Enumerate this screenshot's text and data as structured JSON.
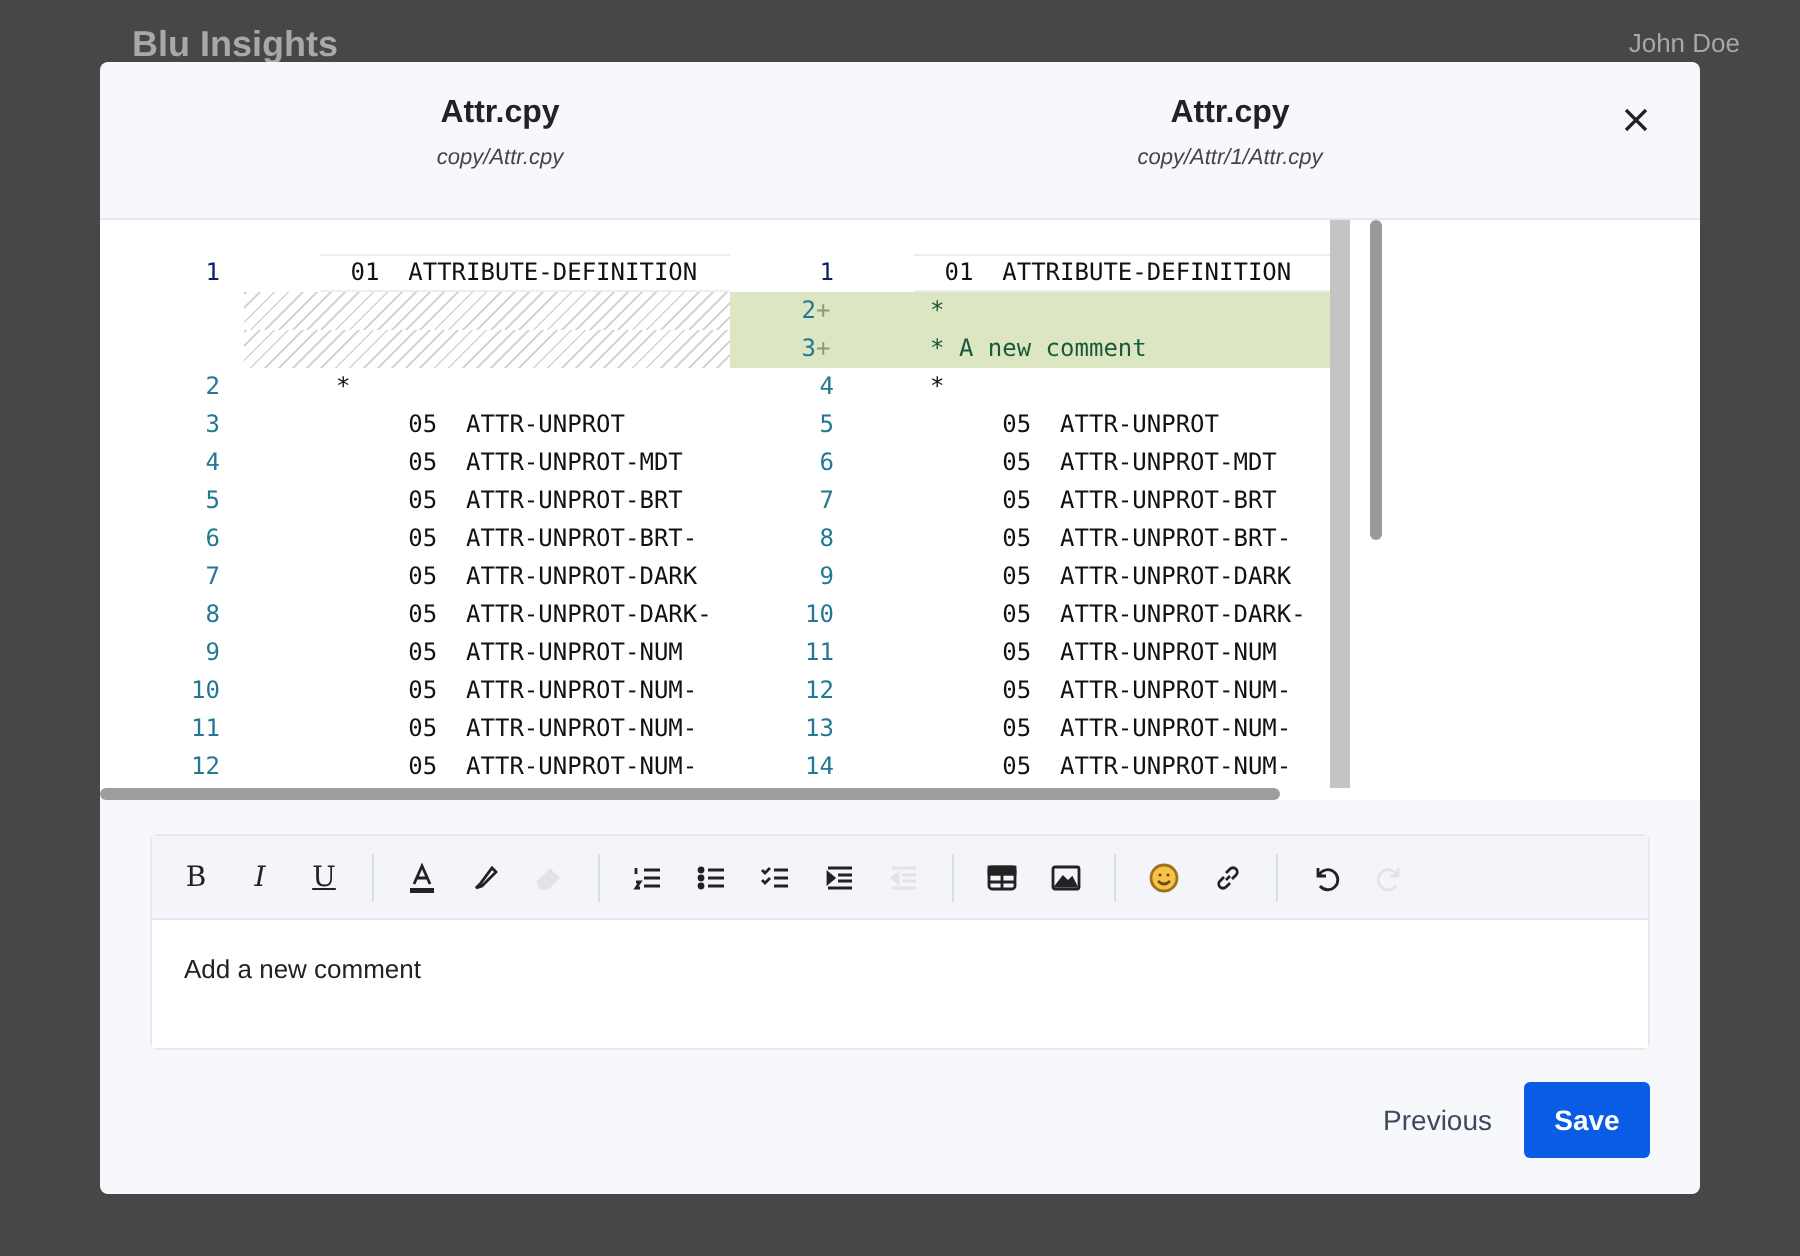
{
  "background": {
    "app_title": "Blu Insights",
    "user_name": "John Doe"
  },
  "dialog": {
    "files": [
      {
        "title": "Attr.cpy",
        "path": "copy/Attr.cpy"
      },
      {
        "title": "Attr.cpy",
        "path": "copy/Attr/1/Attr.cpy"
      }
    ]
  },
  "diff": {
    "left": [
      {
        "kind": "line",
        "num": "1",
        "text": " 01  ATTRIBUTE-DEFINITION",
        "current": true
      },
      {
        "kind": "filler"
      },
      {
        "kind": "filler"
      },
      {
        "kind": "line",
        "num": "2",
        "text": "*",
        "current": false
      },
      {
        "kind": "line",
        "num": "3",
        "text": "     05  ATTR-UNPROT",
        "current": false
      },
      {
        "kind": "line",
        "num": "4",
        "text": "     05  ATTR-UNPROT-MDT",
        "current": false
      },
      {
        "kind": "line",
        "num": "5",
        "text": "     05  ATTR-UNPROT-BRT",
        "current": false
      },
      {
        "kind": "line",
        "num": "6",
        "text": "     05  ATTR-UNPROT-BRT-",
        "current": false
      },
      {
        "kind": "line",
        "num": "7",
        "text": "     05  ATTR-UNPROT-DARK",
        "current": false
      },
      {
        "kind": "line",
        "num": "8",
        "text": "     05  ATTR-UNPROT-DARK-",
        "current": false
      },
      {
        "kind": "line",
        "num": "9",
        "text": "     05  ATTR-UNPROT-NUM",
        "current": false
      },
      {
        "kind": "line",
        "num": "10",
        "text": "     05  ATTR-UNPROT-NUM-",
        "current": false
      },
      {
        "kind": "line",
        "num": "11",
        "text": "     05  ATTR-UNPROT-NUM-",
        "current": false
      },
      {
        "kind": "line",
        "num": "12",
        "text": "     05  ATTR-UNPROT-NUM-",
        "current": false
      }
    ],
    "right": [
      {
        "kind": "line",
        "num": "1",
        "text": " 01  ATTRIBUTE-DEFINITION",
        "current": true
      },
      {
        "kind": "added",
        "num": "2",
        "marker": "+",
        "text": "*"
      },
      {
        "kind": "added",
        "num": "3",
        "marker": "+",
        "text": "* A new comment"
      },
      {
        "kind": "line",
        "num": "4",
        "text": "*",
        "current": false
      },
      {
        "kind": "line",
        "num": "5",
        "text": "     05  ATTR-UNPROT",
        "current": false
      },
      {
        "kind": "line",
        "num": "6",
        "text": "     05  ATTR-UNPROT-MDT",
        "current": false
      },
      {
        "kind": "line",
        "num": "7",
        "text": "     05  ATTR-UNPROT-BRT",
        "current": false
      },
      {
        "kind": "line",
        "num": "8",
        "text": "     05  ATTR-UNPROT-BRT-",
        "current": false
      },
      {
        "kind": "line",
        "num": "9",
        "text": "     05  ATTR-UNPROT-DARK",
        "current": false
      },
      {
        "kind": "line",
        "num": "10",
        "text": "     05  ATTR-UNPROT-DARK-",
        "current": false
      },
      {
        "kind": "line",
        "num": "11",
        "text": "     05  ATTR-UNPROT-NUM",
        "current": false
      },
      {
        "kind": "line",
        "num": "12",
        "text": "     05  ATTR-UNPROT-NUM-",
        "current": false
      },
      {
        "kind": "line",
        "num": "13",
        "text": "     05  ATTR-UNPROT-NUM-",
        "current": false
      },
      {
        "kind": "line",
        "num": "14",
        "text": "     05  ATTR-UNPROT-NUM-",
        "current": false
      }
    ]
  },
  "toolbar": [
    [
      {
        "kind": "bold",
        "label": "B",
        "disabled": false
      },
      {
        "kind": "italic",
        "label": "I",
        "disabled": false
      },
      {
        "kind": "underline",
        "label": "U",
        "disabled": false
      }
    ],
    [
      {
        "kind": "font-color",
        "disabled": false
      },
      {
        "kind": "highlight",
        "disabled": false
      },
      {
        "kind": "eraser",
        "disabled": true
      }
    ],
    [
      {
        "kind": "ordered-list",
        "disabled": false
      },
      {
        "kind": "bullet-list",
        "disabled": false
      },
      {
        "kind": "checklist",
        "disabled": false
      },
      {
        "kind": "indent",
        "disabled": false
      },
      {
        "kind": "outdent",
        "disabled": true
      }
    ],
    [
      {
        "kind": "table",
        "disabled": false
      },
      {
        "kind": "image",
        "disabled": false
      }
    ],
    [
      {
        "kind": "emoji",
        "disabled": false
      },
      {
        "kind": "link",
        "disabled": false
      }
    ],
    [
      {
        "kind": "undo",
        "disabled": false
      },
      {
        "kind": "redo",
        "disabled": true
      }
    ]
  ],
  "editor": {
    "value": "Add a new comment"
  },
  "buttons": [
    {
      "kind": "secondary",
      "label": "Previous"
    },
    {
      "kind": "primary",
      "label": "Save"
    }
  ]
}
